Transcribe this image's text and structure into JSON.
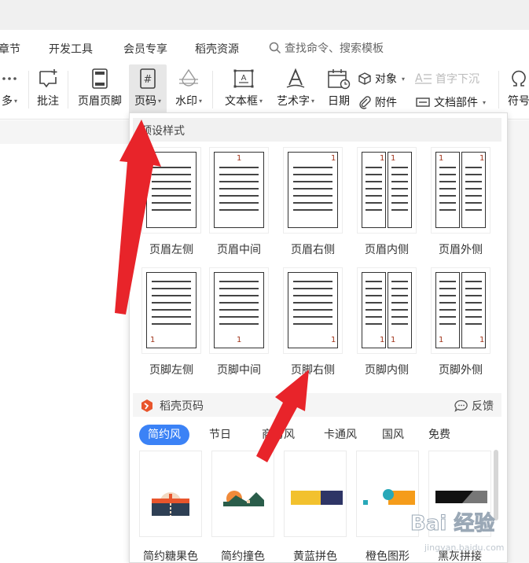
{
  "menubar": {
    "items": [
      "章节",
      "开发工具",
      "会员专享",
      "稻壳资源"
    ],
    "search_placeholder": "查找命令、搜索模板"
  },
  "ribbon": {
    "more_label": "多",
    "comment_label": "批注",
    "header_footer_label": "页眉页脚",
    "page_number_label": "页码",
    "watermark_label": "水印",
    "textbox_label": "文本框",
    "wordart_label": "艺术字",
    "date_label": "日期",
    "object_label": "对象",
    "attachment_label": "附件",
    "dropcap_label": "首字下沉",
    "docpart_label": "文档部件",
    "symbol_label": "符号"
  },
  "dropdown": {
    "preset_title": "预设样式",
    "header_styles": [
      {
        "label": "页眉左侧"
      },
      {
        "label": "页眉中间"
      },
      {
        "label": "页眉右侧"
      },
      {
        "label": "页眉内侧"
      },
      {
        "label": "页眉外侧"
      }
    ],
    "footer_styles": [
      {
        "label": "页脚左侧"
      },
      {
        "label": "页脚中间"
      },
      {
        "label": "页脚右侧"
      },
      {
        "label": "页脚内侧"
      },
      {
        "label": "页脚外侧"
      }
    ],
    "page_num_sample": "1",
    "docer_title": "稻壳页码",
    "feedback_label": "反馈",
    "tabs": [
      "简约风",
      "节日",
      "商务风",
      "卡通风",
      "国风",
      "免费"
    ],
    "active_tab": "简约风",
    "cards": [
      {
        "label": "简约糖果色"
      },
      {
        "label": "简约撞色"
      },
      {
        "label": "黄蓝拼色"
      },
      {
        "label": "橙色图形"
      },
      {
        "label": "黑灰拼接"
      }
    ]
  },
  "colors": {
    "accent_blue": "#3b82f6",
    "arrow_red": "#e8242a",
    "docer_orange": "#e8552c",
    "page_num_color": "#a0341a"
  },
  "watermark": {
    "text": "Bai 经验",
    "sub": "jingyan.baidu.com"
  }
}
